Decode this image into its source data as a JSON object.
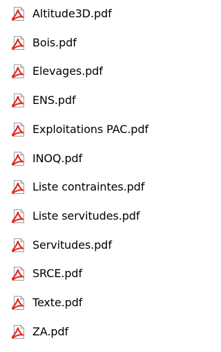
{
  "icons": {
    "file_type": "pdf-file-icon",
    "accent_color": "#e02a20",
    "page_color": "#ffffff",
    "page_border_color": "#9a9a9a",
    "fold_color": "#d8d8d8"
  },
  "files": [
    {
      "name": "Altitude3D.pdf"
    },
    {
      "name": "Bois.pdf"
    },
    {
      "name": "Elevages.pdf"
    },
    {
      "name": "ENS.pdf"
    },
    {
      "name": "Exploitations PAC.pdf"
    },
    {
      "name": "INOQ.pdf"
    },
    {
      "name": "Liste contraintes.pdf"
    },
    {
      "name": "Liste servitudes.pdf"
    },
    {
      "name": "Servitudes.pdf"
    },
    {
      "name": "SRCE.pdf"
    },
    {
      "name": "Texte.pdf"
    },
    {
      "name": "ZA.pdf"
    }
  ]
}
